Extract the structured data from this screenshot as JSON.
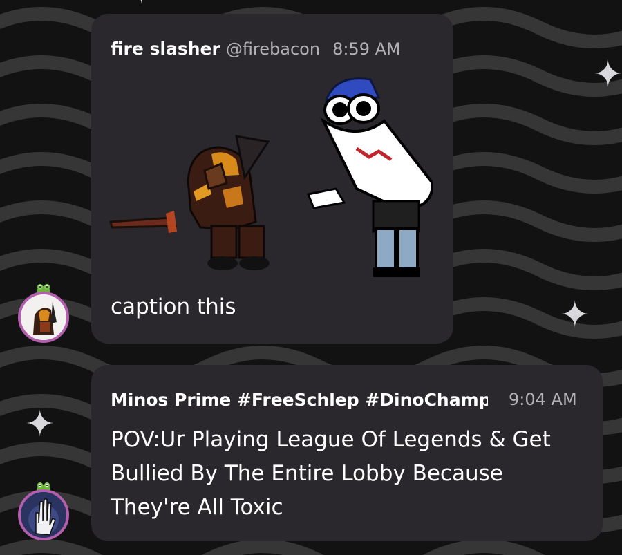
{
  "messages": [
    {
      "author": "fire slasher",
      "handle": "@firebacon",
      "time": "8:59 AM",
      "text": "caption this",
      "attachment_icon": "image-attachment"
    },
    {
      "author": "Minos Prime #FreeSchlep #DinoChamp",
      "time": "9:04 AM",
      "text": "POV:Ur Playing League Of Legends & Get Bullied By The Entire Lobby Because They're All Toxic"
    }
  ],
  "colors": {
    "bubble": "#2a282c",
    "avatar_ring": "#b35fae",
    "meta_text": "#b3b1b6"
  }
}
